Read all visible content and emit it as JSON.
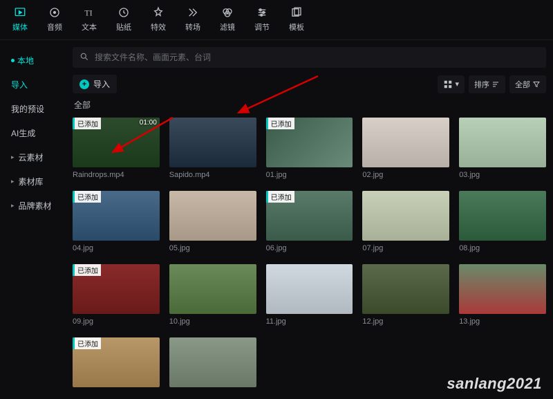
{
  "top_tabs": [
    {
      "id": "media",
      "label": "媒体",
      "active": true
    },
    {
      "id": "audio",
      "label": "音频"
    },
    {
      "id": "text",
      "label": "文本"
    },
    {
      "id": "sticker",
      "label": "贴纸"
    },
    {
      "id": "effect",
      "label": "特效"
    },
    {
      "id": "transition",
      "label": "转场"
    },
    {
      "id": "filter",
      "label": "滤镜"
    },
    {
      "id": "adjust",
      "label": "调节"
    },
    {
      "id": "template",
      "label": "模板"
    }
  ],
  "sidebar": {
    "items": [
      {
        "id": "local",
        "label": "本地",
        "style": "dot",
        "active": true
      },
      {
        "id": "import",
        "label": "导入",
        "style": "plain",
        "accent": true
      },
      {
        "id": "my-preset",
        "label": "我的预设",
        "style": "plain"
      },
      {
        "id": "ai-gen",
        "label": "AI生成",
        "style": "plain"
      },
      {
        "id": "cloud",
        "label": "云素材",
        "style": "expand"
      },
      {
        "id": "library",
        "label": "素材库",
        "style": "expand"
      },
      {
        "id": "brand",
        "label": "品牌素材",
        "style": "expand"
      }
    ]
  },
  "search": {
    "placeholder": "搜索文件名称、画面元素、台词"
  },
  "toolbar": {
    "import_label": "导入",
    "sort_label": "排序",
    "all_label": "全部"
  },
  "section_title": "全部",
  "badge_text": "已添加",
  "media_grid": [
    {
      "label": "Raindrops.mp4",
      "badge": true,
      "duration": "01:00",
      "bg": "rain"
    },
    {
      "label": "Sapido.mp4",
      "badge": false,
      "bg": "city"
    },
    {
      "label": "01.jpg",
      "badge": true,
      "bg": "p1"
    },
    {
      "label": "02.jpg",
      "badge": false,
      "bg": "p2"
    },
    {
      "label": "03.jpg",
      "badge": false,
      "bg": "p3"
    },
    {
      "label": "04.jpg",
      "badge": true,
      "bg": "p4"
    },
    {
      "label": "05.jpg",
      "badge": false,
      "bg": "p5"
    },
    {
      "label": "06.jpg",
      "badge": true,
      "bg": "p6"
    },
    {
      "label": "07.jpg",
      "badge": false,
      "bg": "p7"
    },
    {
      "label": "08.jpg",
      "badge": false,
      "bg": "p8"
    },
    {
      "label": "09.jpg",
      "badge": true,
      "bg": "p9"
    },
    {
      "label": "10.jpg",
      "badge": false,
      "bg": "p10"
    },
    {
      "label": "11.jpg",
      "badge": false,
      "bg": "p11"
    },
    {
      "label": "12.jpg",
      "badge": false,
      "bg": "p12"
    },
    {
      "label": "13.jpg",
      "badge": false,
      "bg": "p13"
    },
    {
      "label": "",
      "badge": true,
      "bg": "p14"
    },
    {
      "label": "",
      "badge": false,
      "bg": "p15"
    }
  ],
  "watermark": "sanlang2021"
}
